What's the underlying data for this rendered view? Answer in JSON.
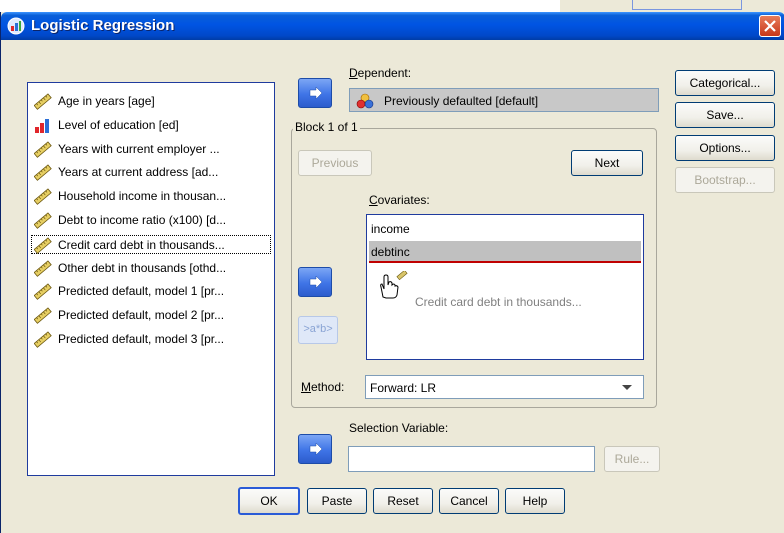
{
  "window": {
    "title": "Logistic Regression"
  },
  "variables": [
    {
      "label": "Age in years [age]",
      "icon": "scale-ruler-icon"
    },
    {
      "label": "Level of education [ed]",
      "icon": "ordinal-bars-icon"
    },
    {
      "label": "Years with current employer ...",
      "icon": "scale-ruler-icon"
    },
    {
      "label": "Years at current address [ad...",
      "icon": "scale-ruler-icon"
    },
    {
      "label": "Household income in thousan...",
      "icon": "scale-ruler-icon"
    },
    {
      "label": "Debt to income ratio (x100) [d...",
      "icon": "scale-ruler-icon"
    },
    {
      "label": "Credit card debt in thousands...",
      "icon": "scale-ruler-icon",
      "selected": true
    },
    {
      "label": "Other debt in thousands [othd...",
      "icon": "scale-ruler-icon"
    },
    {
      "label": "Predicted default, model 1 [pr...",
      "icon": "scale-ruler-icon"
    },
    {
      "label": "Predicted default, model 2 [pr...",
      "icon": "scale-ruler-icon"
    },
    {
      "label": "Predicted default, model 3 [pr...",
      "icon": "scale-ruler-icon"
    }
  ],
  "dependent": {
    "label": "Dependent:",
    "value": "Previously defaulted [default]"
  },
  "block": {
    "title": "Block 1 of 1",
    "previous": "Previous",
    "next": "Next"
  },
  "covariates": {
    "label": "Covariates:",
    "items": [
      "income",
      "debtinc"
    ],
    "drag_hint": "Credit card debt in thousands..."
  },
  "interaction_button": ">a*b>",
  "method": {
    "label": "Method:",
    "value": "Forward: LR"
  },
  "selection": {
    "label": "Selection Variable:",
    "value": "",
    "rule": "Rule..."
  },
  "side_buttons": {
    "categorical": "Categorical...",
    "save": "Save...",
    "options": "Options...",
    "bootstrap": "Bootstrap..."
  },
  "bottom_buttons": {
    "ok": "OK",
    "paste": "Paste",
    "reset": "Reset",
    "cancel": "Cancel",
    "help": "Help"
  },
  "colors": {
    "title_blue": "#0054e3",
    "list_border": "#1f3b9e",
    "highlight": "#c0c0c0",
    "drop_line": "#c00000"
  }
}
